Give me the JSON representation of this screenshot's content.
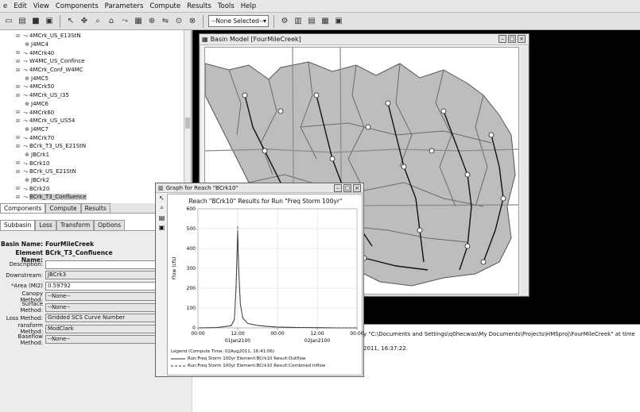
{
  "menu": [
    "e",
    "Edit",
    "View",
    "Components",
    "Parameters",
    "Compute",
    "Results",
    "Tools",
    "Help"
  ],
  "toolbar": {
    "selector_value": "--None Selected--"
  },
  "tree": {
    "items": [
      {
        "label": "4MCrk_US_E13StN",
        "type": "reach",
        "expandable": true
      },
      {
        "label": "J4MC4",
        "type": "junction",
        "expandable": false
      },
      {
        "label": "4MCrk40",
        "type": "reach",
        "expandable": true
      },
      {
        "label": "W4MC_US_Confince",
        "type": "reach",
        "expandable": true
      },
      {
        "label": "4MCrk_Conf_W4MC",
        "type": "reach",
        "expandable": true
      },
      {
        "label": "J4MC5",
        "type": "junction",
        "expandable": false
      },
      {
        "label": "4MCrk50",
        "type": "reach",
        "expandable": true
      },
      {
        "label": "4MCrk_US_I35",
        "type": "reach",
        "expandable": true
      },
      {
        "label": "J4MC6",
        "type": "junction",
        "expandable": false
      },
      {
        "label": "4MCrk60",
        "type": "reach",
        "expandable": true
      },
      {
        "label": "4MCrk_US_US54",
        "type": "reach",
        "expandable": true
      },
      {
        "label": "J4MC7",
        "type": "junction",
        "expandable": false
      },
      {
        "label": "4MCrk70",
        "type": "reach",
        "expandable": true
      },
      {
        "label": "BCrk_T3_US_E21StN",
        "type": "reach",
        "expandable": true
      },
      {
        "label": "JBCrk1",
        "type": "junction",
        "expandable": false
      },
      {
        "label": "BCrk10",
        "type": "reach",
        "expandable": true
      },
      {
        "label": "BCrk_US_E21StN",
        "type": "reach",
        "expandable": true
      },
      {
        "label": "JBCrk2",
        "type": "junction",
        "expandable": false
      },
      {
        "label": "BCrk20",
        "type": "reach",
        "expandable": true
      },
      {
        "label": "BCrk_T3_Confluence",
        "type": "reach",
        "expandable": true,
        "selected": true
      }
    ]
  },
  "tabs_top": [
    "Components",
    "Compute",
    "Results"
  ],
  "tabs_props": [
    "Subbasin",
    "Loss",
    "Transform",
    "Options"
  ],
  "props": {
    "basin_name_label": "Basin Name:",
    "basin_name": "FourMileCreek",
    "element_name_label": "Element Name:",
    "element_name": "BCrk_T3_Confluence",
    "rows": [
      {
        "label": "Description:",
        "value": "",
        "white": true
      },
      {
        "label": "Downstream:",
        "value": "JBCrk3",
        "white": false
      },
      {
        "label": "*Area (MI2)",
        "value": "0.59792",
        "white": true
      },
      {
        "label": "Canopy Method:",
        "value": "--None--",
        "white": false
      },
      {
        "label": "Surface Method:",
        "value": "--None--",
        "white": false
      },
      {
        "label": "Loss Method:",
        "value": "Gridded SCS Curve Number",
        "white": false
      },
      {
        "label": "ransform Method:",
        "value": "ModClark",
        "white": false
      },
      {
        "label": "Baseflow Method:",
        "value": "--None--",
        "white": false
      }
    ]
  },
  "basin_window": {
    "title": "Basin Model [FourMileCreek]"
  },
  "graph_window": {
    "title": "Graph for Reach \"BCrk10\""
  },
  "chart_data": {
    "type": "line",
    "title": "Reach \"BCrk10\" Results for Run \"Freq Storm 100yr\"",
    "ylabel": "Flow (cfs)",
    "xlabel": "",
    "ylim": [
      0,
      600
    ],
    "yticks": [
      "600",
      "500",
      "400",
      "300",
      "200",
      "100",
      "0"
    ],
    "xticks": [
      "00:00",
      "12:00",
      "00:00",
      "12:00",
      "00:00"
    ],
    "date_labels": [
      "01Jan2100",
      "02Jan2100"
    ],
    "grid": true,
    "series": [
      {
        "name": "Run:Freq Storm 100yr Element:BCrk10 Result:Outflow",
        "style": "solid",
        "x": [
          0,
          6,
          10,
          11,
          11.5,
          12,
          12.3,
          12.8,
          13.5,
          15,
          18,
          22,
          24,
          30,
          36,
          42,
          48
        ],
        "y": [
          0,
          2,
          10,
          40,
          200,
          480,
          300,
          120,
          50,
          22,
          12,
          6,
          4,
          2,
          1,
          0,
          0
        ]
      },
      {
        "name": "Run:Freq Storm 100yr Element:BCrk10 Result:Combined Inflow",
        "style": "dashed",
        "x": [
          0,
          6,
          10,
          11,
          11.5,
          12,
          12.2,
          12.7,
          13.5,
          15,
          18,
          22,
          24,
          30,
          36,
          42,
          48
        ],
        "y": [
          0,
          2,
          12,
          45,
          230,
          515,
          330,
          130,
          52,
          23,
          12,
          6,
          4,
          2,
          1,
          0,
          0
        ]
      }
    ],
    "legend_title": "Legend (Compute Time: 02Aug2011, 16:41:06)"
  },
  "messages": [
    "y \"C:\\Documents and Settings\\q0hecwas\\My Documents\\Projects\\HMSproj\\FourMileCreek\" at time",
    "2011, 16:37:22."
  ]
}
